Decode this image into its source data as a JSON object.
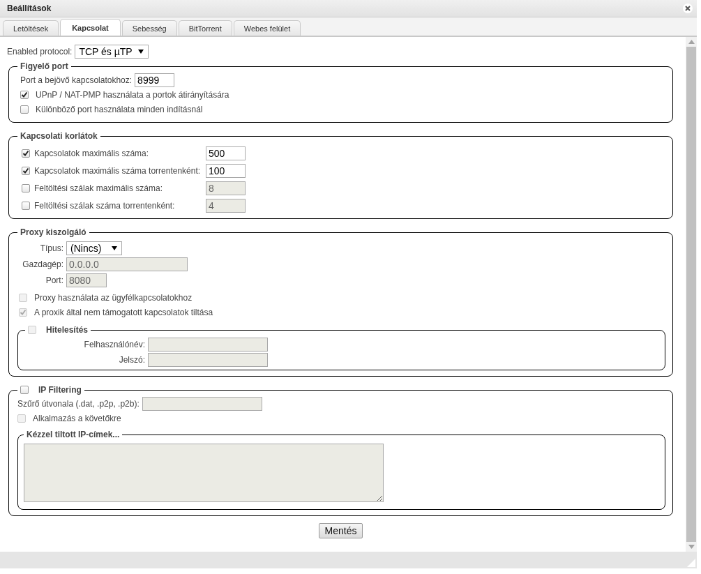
{
  "window": {
    "title": "Beállítások"
  },
  "tabs": [
    {
      "label": "Letöltések",
      "selected": false
    },
    {
      "label": "Kapcsolat",
      "selected": true
    },
    {
      "label": "Sebesség",
      "selected": false
    },
    {
      "label": "BitTorrent",
      "selected": false
    },
    {
      "label": "Webes felület",
      "selected": false
    }
  ],
  "protocol": {
    "label": "Enabled protocol:",
    "value": "TCP és µTP"
  },
  "listening_port": {
    "title": "Figyelő port",
    "port_label": "Port a bejövő kapcsolatokhoz:",
    "port_value": "8999",
    "options": [
      {
        "label": "UPnP / NAT-PMP használata a portok átirányítására",
        "checked": true,
        "disabled": false
      },
      {
        "label": "Különböző port használata minden indításnál",
        "checked": false,
        "disabled": false
      }
    ]
  },
  "connection_limits": {
    "title": "Kapcsolati korlátok",
    "rows": [
      {
        "label": "Kapcsolatok maximális száma:",
        "checked": true,
        "value": "500"
      },
      {
        "label": "Kapcsolatok maximális száma torrentenként:",
        "checked": true,
        "value": "100"
      },
      {
        "label": "Feltöltési szálak maximális száma:",
        "checked": false,
        "value": "8"
      },
      {
        "label": "Feltöltési szálak száma torrentenként:",
        "checked": false,
        "value": "4"
      }
    ]
  },
  "proxy": {
    "title": "Proxy kiszolgáló",
    "type_label": "Típus:",
    "type_value": "(Nincs)",
    "host_label": "Gazdagép:",
    "host_value": "0.0.0.0",
    "port_label": "Port:",
    "port_value": "8080",
    "options": [
      {
        "label": "Proxy használata az ügyfélkapcsolatokhoz",
        "checked": false,
        "disabled": true
      },
      {
        "label": "A proxik által nem támogatott kapcsolatok tiltása",
        "checked": true,
        "disabled": true
      }
    ],
    "authentication": {
      "title": "Hitelesítés",
      "checked": false,
      "disabled": true,
      "username_label": "Felhasználónév:",
      "password_label": "Jelszó:"
    }
  },
  "ip_filtering": {
    "title": "IP Filtering",
    "checked": false,
    "disabled": false,
    "path_label": "Szűrő útvonala (.dat, .p2p, .p2b):",
    "apply": {
      "label": "Alkalmazás a követőkre",
      "checked": false,
      "disabled": true
    },
    "banned_title": "Kézzel tiltott IP-címek..."
  },
  "save_button": "Mentés"
}
